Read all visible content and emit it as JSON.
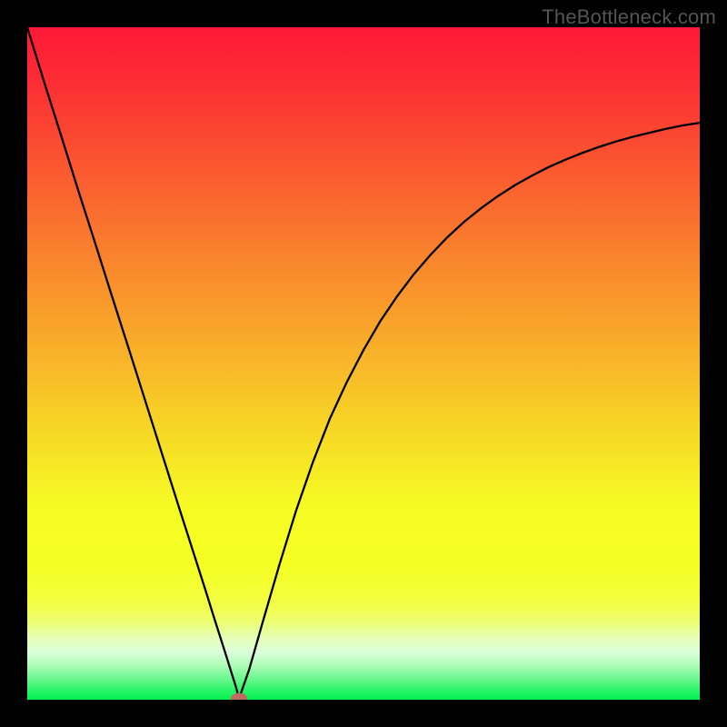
{
  "watermark": "TheBottleneck.com",
  "chart_data": {
    "type": "line",
    "title": "",
    "xlabel": "",
    "ylabel": "",
    "xlim": [
      0,
      100
    ],
    "ylim": [
      0,
      100
    ],
    "series": [
      {
        "name": "curve",
        "x": [
          0.0,
          2.5,
          5.0,
          7.5,
          10.0,
          12.5,
          15.0,
          17.5,
          20.0,
          22.5,
          25.0,
          26.5,
          28.0,
          29.5,
          31.0,
          31.5,
          33.0,
          35.0,
          37.5,
          40.0,
          42.5,
          45.0,
          47.5,
          50.0,
          52.5,
          55.0,
          57.5,
          60.0,
          62.5,
          65.0,
          67.5,
          70.0,
          72.5,
          75.0,
          77.5,
          80.0,
          82.5,
          85.0,
          87.5,
          90.0,
          92.5,
          95.0,
          97.5,
          100.0
        ],
        "y": [
          100.0,
          91.9,
          84.0,
          76.0,
          68.2,
          60.3,
          52.5,
          44.6,
          36.7,
          28.8,
          21.0,
          16.3,
          11.5,
          6.8,
          2.0,
          0.2,
          4.5,
          11.5,
          20.1,
          28.2,
          35.4,
          41.8,
          47.2,
          52.0,
          56.3,
          60.0,
          63.3,
          66.2,
          68.8,
          71.1,
          73.1,
          74.9,
          76.5,
          77.9,
          79.2,
          80.3,
          81.3,
          82.2,
          83.0,
          83.7,
          84.3,
          84.9,
          85.4,
          85.8
        ]
      }
    ],
    "marker": {
      "x": 31.5,
      "y": 0.2,
      "color": "#bf6b63"
    },
    "background_gradient": {
      "stops": [
        {
          "offset": 0.0,
          "color": "#fd1937"
        },
        {
          "offset": 0.08,
          "color": "#fc2d34"
        },
        {
          "offset": 0.18,
          "color": "#fb4e31"
        },
        {
          "offset": 0.28,
          "color": "#fa6f2e"
        },
        {
          "offset": 0.38,
          "color": "#f9902c"
        },
        {
          "offset": 0.48,
          "color": "#f8b029"
        },
        {
          "offset": 0.58,
          "color": "#f7d126"
        },
        {
          "offset": 0.68,
          "color": "#f6f124"
        },
        {
          "offset": 0.72,
          "color": "#f6fd23"
        },
        {
          "offset": 0.8,
          "color": "#f5fe23"
        },
        {
          "offset": 0.85,
          "color": "#f3fe3d"
        },
        {
          "offset": 0.88,
          "color": "#eefe69"
        },
        {
          "offset": 0.91,
          "color": "#e6febb"
        },
        {
          "offset": 0.93,
          "color": "#daffdb"
        },
        {
          "offset": 0.95,
          "color": "#aafcb5"
        },
        {
          "offset": 0.97,
          "color": "#67f78c"
        },
        {
          "offset": 0.985,
          "color": "#2ef46b"
        },
        {
          "offset": 1.0,
          "color": "#01f251"
        }
      ]
    }
  }
}
